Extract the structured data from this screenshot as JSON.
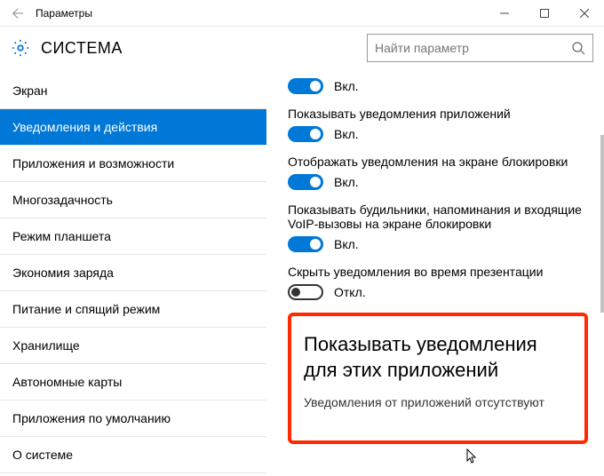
{
  "window": {
    "title": "Параметры"
  },
  "header": {
    "title": "СИСТЕМА",
    "search_placeholder": "Найти параметр"
  },
  "sidebar": {
    "items": [
      "Экран",
      "Уведомления и действия",
      "Приложения и возможности",
      "Многозадачность",
      "Режим планшета",
      "Экономия заряда",
      "Питание и спящий режим",
      "Хранилище",
      "Автономные карты",
      "Приложения по умолчанию",
      "О системе"
    ],
    "active_index": 1
  },
  "toggles": [
    {
      "desc": "",
      "state": "on",
      "label": "Вкл."
    },
    {
      "desc": "Показывать уведомления приложений",
      "state": "on",
      "label": "Вкл."
    },
    {
      "desc": "Отображать уведомления на экране блокировки",
      "state": "on",
      "label": "Вкл."
    },
    {
      "desc": "Показывать будильники, напоминания и входящие VoIP-вызовы на экране блокировки",
      "state": "on",
      "label": "Вкл."
    },
    {
      "desc": "Скрыть уведомления во время презентации",
      "state": "off",
      "label": "Откл."
    }
  ],
  "highlight": {
    "title": "Показывать уведомления для этих приложений",
    "subtitle": "Уведомления от приложений отсутствуют"
  }
}
